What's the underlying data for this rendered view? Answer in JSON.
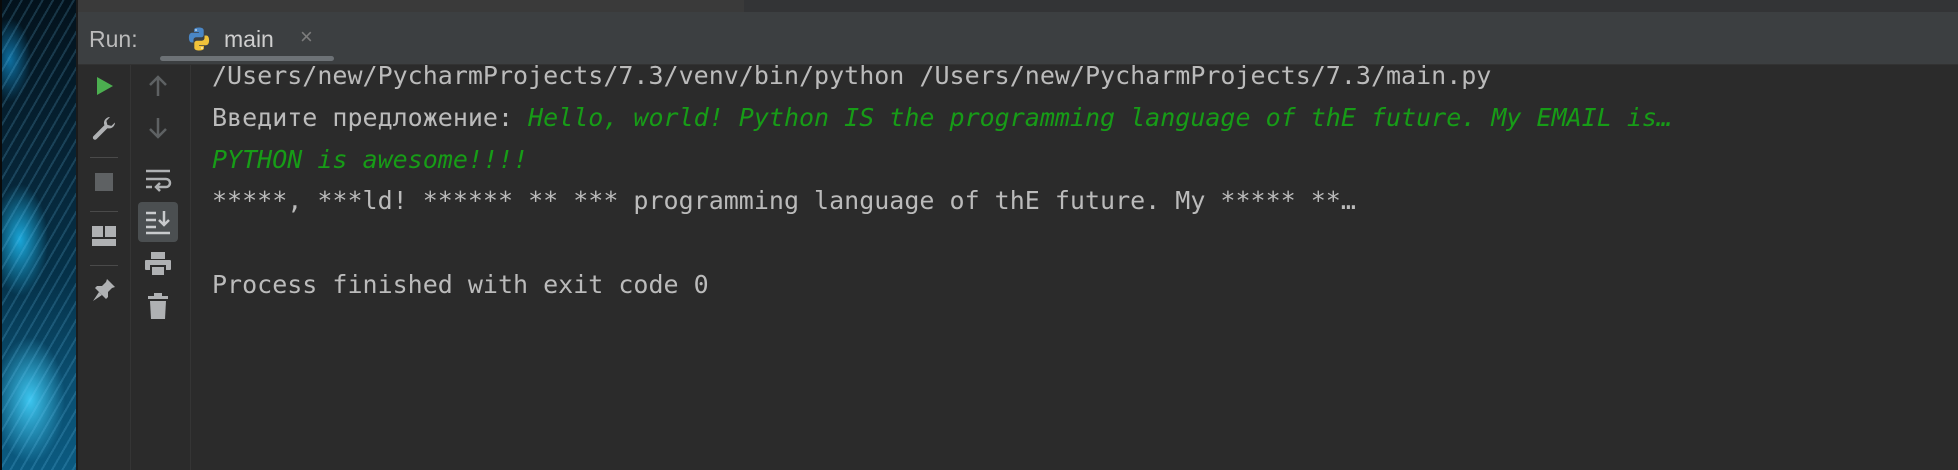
{
  "run_panel": {
    "label": "Run:",
    "tab": {
      "name": "main",
      "close": "×",
      "icon": "python-icon"
    }
  },
  "toolbar": {
    "left": [
      "run-icon",
      "wrench-icon",
      "stop-icon",
      "layout-icon",
      "pin-icon"
    ],
    "right": [
      "arrow-up-icon",
      "arrow-down-icon",
      "soft-wrap-icon",
      "scroll-to-end-icon",
      "print-icon",
      "trash-icon"
    ]
  },
  "console": {
    "command": "/Users/new/PycharmProjects/7.3/venv/bin/python /Users/new/PycharmProjects/7.3/main.py",
    "prompt": "Введите предложение: ",
    "input_line1": "Hello, world! Python IS the programming language of thE future. My EMAIL is…",
    "input_line2": "PYTHON is awesome!!!!",
    "output": "*****, ***ld! ****** ** *** programming language of thE future. My ***** **…",
    "exit_message": "Process finished with exit code 0"
  },
  "colors": {
    "background": "#2b2b2b",
    "text": "#bbbbbb",
    "input": "#179c17",
    "run_green": "#4caf50"
  }
}
